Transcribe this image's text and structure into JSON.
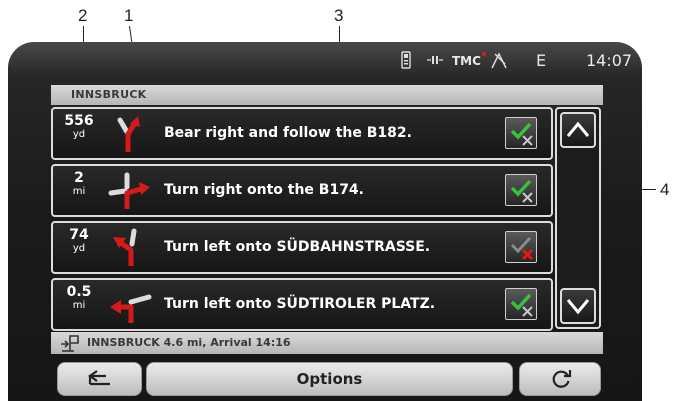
{
  "callouts": {
    "c1": "1",
    "c2": "2",
    "c3": "3",
    "c4": "4"
  },
  "status": {
    "tmc": "TMC",
    "direction": "E",
    "time": "14:07",
    "icons": [
      "phone-icon",
      "battery-icon",
      "tmc-icon",
      "gps-satellite-icon"
    ]
  },
  "breadcrumb": "INNSBRUCK",
  "routes": [
    {
      "dist": "556",
      "unit": "yd",
      "instruction": "Bear right and follow the B182.",
      "arrow": "bear-right-arrow-icon",
      "checked": true
    },
    {
      "dist": "2",
      "unit": "mi",
      "instruction": "Turn right onto the B174.",
      "arrow": "turn-right-arrow-icon",
      "checked": true
    },
    {
      "dist": "74",
      "unit": "yd",
      "instruction": "Turn left onto SÜDBAHNSTRASSE.",
      "arrow": "turn-left-arrow-icon",
      "checked": false
    },
    {
      "dist": "0.5",
      "unit": "mi",
      "instruction": "Turn left onto SÜDTIROLER PLATZ.",
      "arrow": "turn-left-arrow-icon",
      "checked": true
    }
  ],
  "info": "INNSBRUCK 4.6 mi, Arrival 14:16",
  "buttons": {
    "back": "back-icon",
    "options": "Options",
    "refresh": "refresh-icon"
  },
  "colors": {
    "arrow_red": "#d41a1a",
    "check_green": "#36c23a",
    "x_red": "#e01818",
    "screen_bg": "#1a1a1a"
  }
}
